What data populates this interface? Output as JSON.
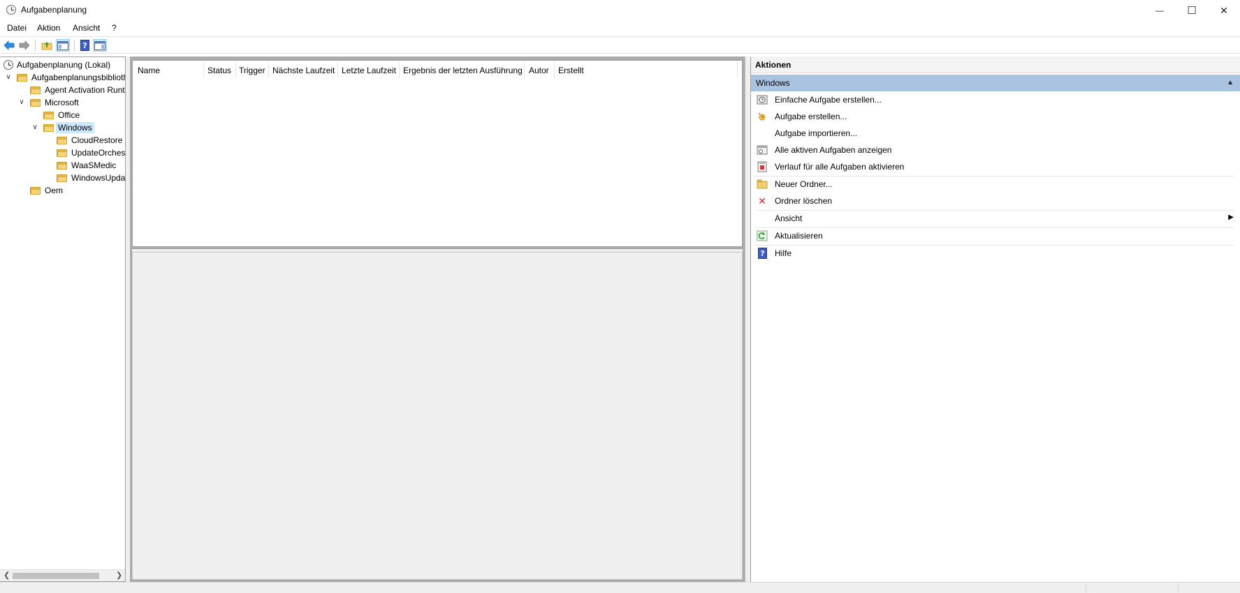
{
  "window": {
    "title": "Aufgabenplanung",
    "minimize_glyph": "—",
    "maximize_glyph": "☐",
    "close_glyph": "✕"
  },
  "menu": {
    "items": [
      "Datei",
      "Aktion",
      "Ansicht",
      "?"
    ]
  },
  "toolbar": {
    "icons": [
      "back-arrow-icon",
      "forward-arrow-icon",
      "up-folder-icon",
      "show-hide-console-tree-icon",
      "help-icon",
      "show-hide-action-pane-icon"
    ]
  },
  "tree": {
    "items": [
      {
        "label": "Aufgabenplanung (Lokal)",
        "icon": "clock-icon"
      },
      {
        "label": "Aufgabenplanungsbibliothek",
        "icon": "clock-folder-icon",
        "expanded": true
      },
      {
        "label": "Agent Activation Runtime",
        "icon": "folder-icon"
      },
      {
        "label": "Microsoft",
        "icon": "folder-icon",
        "expanded": true
      },
      {
        "label": "Office",
        "icon": "folder-icon"
      },
      {
        "label": "Windows",
        "icon": "folder-icon",
        "expanded": true,
        "selected": true
      },
      {
        "label": "CloudRestore",
        "icon": "folder-icon"
      },
      {
        "label": "UpdateOrchestrator",
        "icon": "folder-icon"
      },
      {
        "label": "WaaSMedic",
        "icon": "folder-icon"
      },
      {
        "label": "WindowsUpdate",
        "icon": "folder-icon"
      },
      {
        "label": "Oem",
        "icon": "folder-icon"
      }
    ]
  },
  "task_list": {
    "columns": [
      "Name",
      "Status",
      "Trigger",
      "Nächste Laufzeit",
      "Letzte Laufzeit",
      "Ergebnis der letzten Ausführung",
      "Autor",
      "Erstellt"
    ],
    "rows": []
  },
  "actions": {
    "header": "Aktionen",
    "section_title": "Windows",
    "items": [
      {
        "label": "Einfache Aufgabe erstellen...",
        "icon": "basic-task-wizard-icon"
      },
      {
        "label": "Aufgabe erstellen...",
        "icon": "create-task-icon"
      },
      {
        "label": "Aufgabe importieren...",
        "icon": ""
      },
      {
        "label": "Alle aktiven Aufgaben anzeigen",
        "icon": "running-tasks-icon"
      },
      {
        "label": "Verlauf für alle Aufgaben aktivieren",
        "icon": "history-icon"
      },
      {
        "label": "Neuer Ordner...",
        "icon": "new-folder-icon"
      },
      {
        "label": "Ordner löschen",
        "icon": "delete-icon"
      },
      {
        "label": "Ansicht",
        "icon": "",
        "submenu": true
      },
      {
        "label": "Aktualisieren",
        "icon": "refresh-icon"
      },
      {
        "label": "Hilfe",
        "icon": "help-icon"
      }
    ]
  },
  "colors": {
    "selection": "#cce8ff",
    "section_header": "#a9c3e0",
    "delete_red": "#d9262c",
    "help_blue": "#2f4ea8"
  }
}
